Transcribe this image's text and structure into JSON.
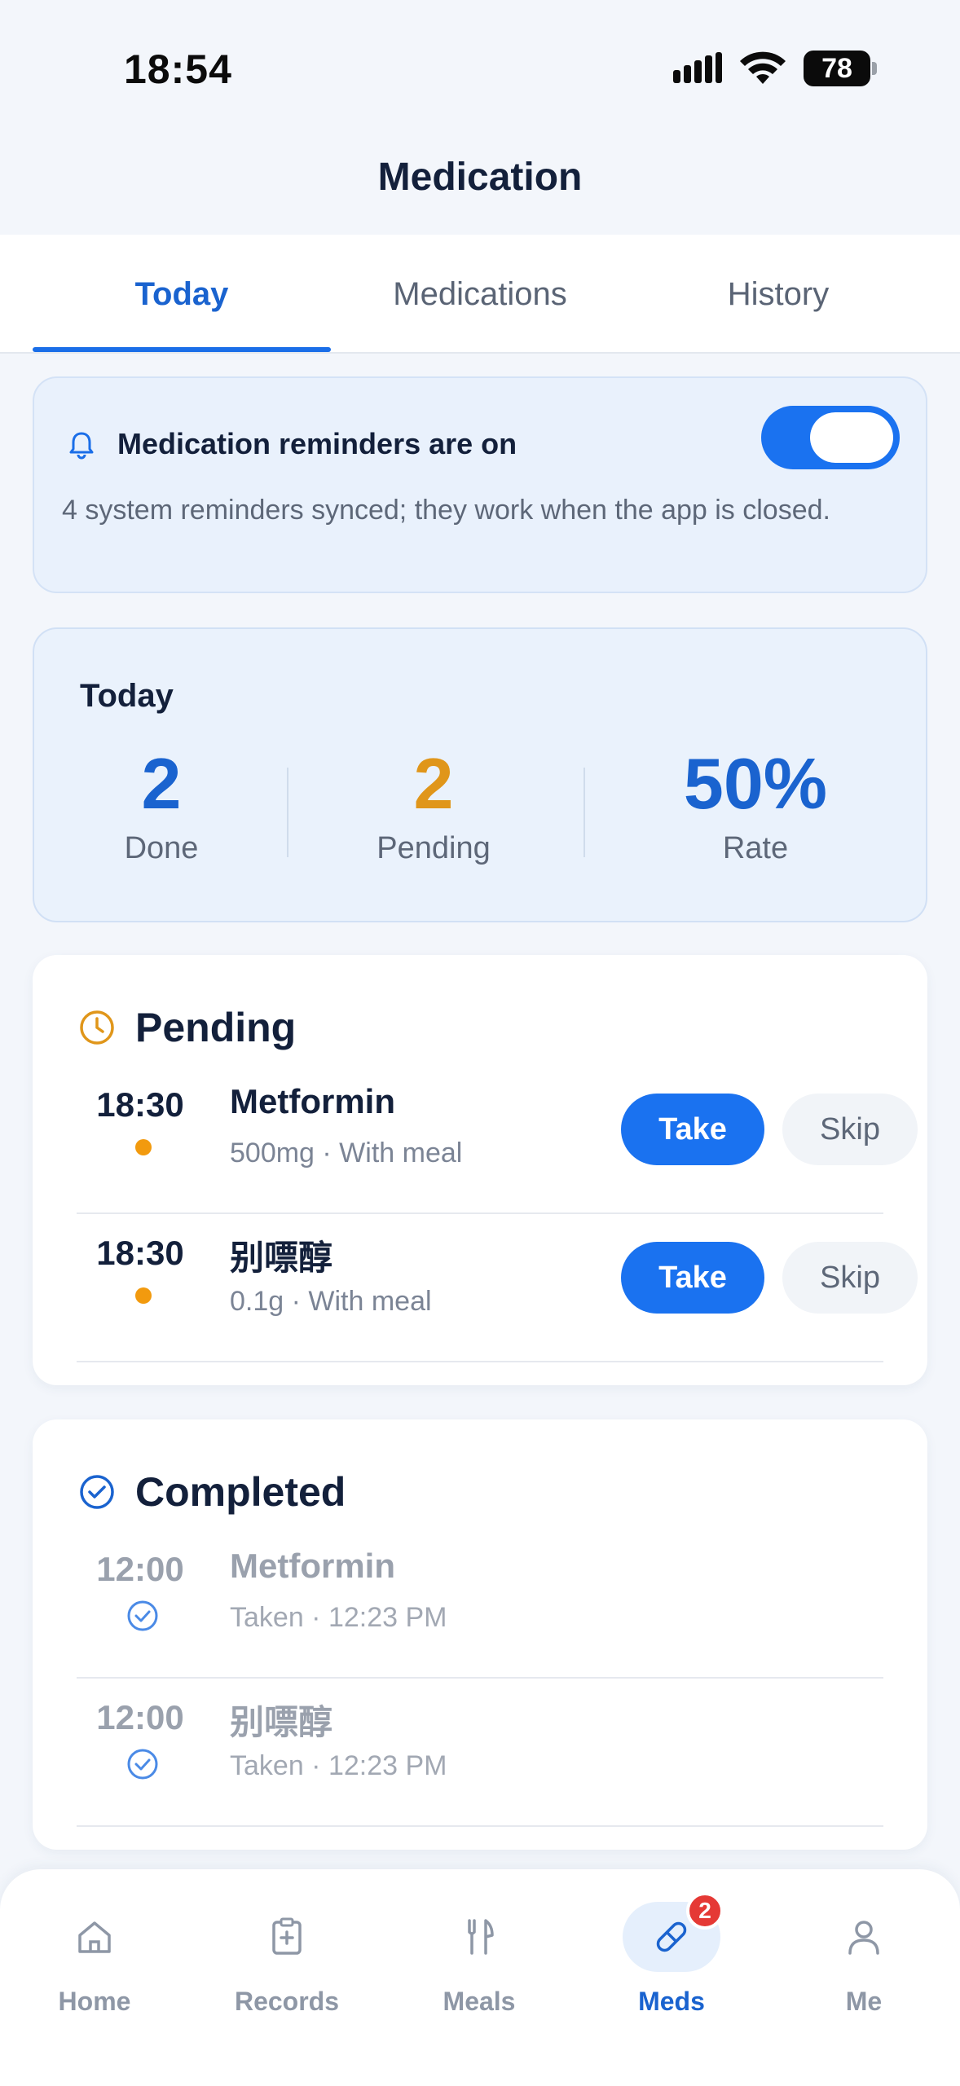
{
  "status_bar": {
    "time": "18:54",
    "battery": "78"
  },
  "page_title": "Medication",
  "tabs": [
    {
      "label": "Today",
      "active": true
    },
    {
      "label": "Medications",
      "active": false
    },
    {
      "label": "History",
      "active": false
    }
  ],
  "reminder": {
    "title": "Medication reminders are on",
    "description": "4 system reminders synced; they work when the app is closed.",
    "enabled": true
  },
  "summary": {
    "title": "Today",
    "done": {
      "value": "2",
      "label": "Done"
    },
    "pending": {
      "value": "2",
      "label": "Pending"
    },
    "rate": {
      "value": "50%",
      "label": "Rate"
    }
  },
  "pending": {
    "title": "Pending",
    "items": [
      {
        "time": "18:30",
        "name": "Metformin",
        "detail": "500mg · With meal",
        "take_label": "Take",
        "skip_label": "Skip"
      },
      {
        "time": "18:30",
        "name": "别嘌醇",
        "detail": "0.1g · With meal",
        "take_label": "Take",
        "skip_label": "Skip"
      }
    ]
  },
  "completed": {
    "title": "Completed",
    "items": [
      {
        "time": "12:00",
        "name": "Metformin",
        "detail": "Taken · 12:23 PM"
      },
      {
        "time": "12:00",
        "name": "别嘌醇",
        "detail": "Taken · 12:23 PM"
      }
    ]
  },
  "nav": {
    "items": [
      {
        "label": "Home",
        "icon": "home-icon"
      },
      {
        "label": "Records",
        "icon": "clipboard-icon"
      },
      {
        "label": "Meals",
        "icon": "utensils-icon"
      },
      {
        "label": "Meds",
        "icon": "pill-icon",
        "badge": "2",
        "active": true
      },
      {
        "label": "Me",
        "icon": "user-icon"
      }
    ]
  },
  "colors": {
    "accent": "#1a72f0",
    "pending": "#e0961a",
    "done": "#1a63cf"
  }
}
